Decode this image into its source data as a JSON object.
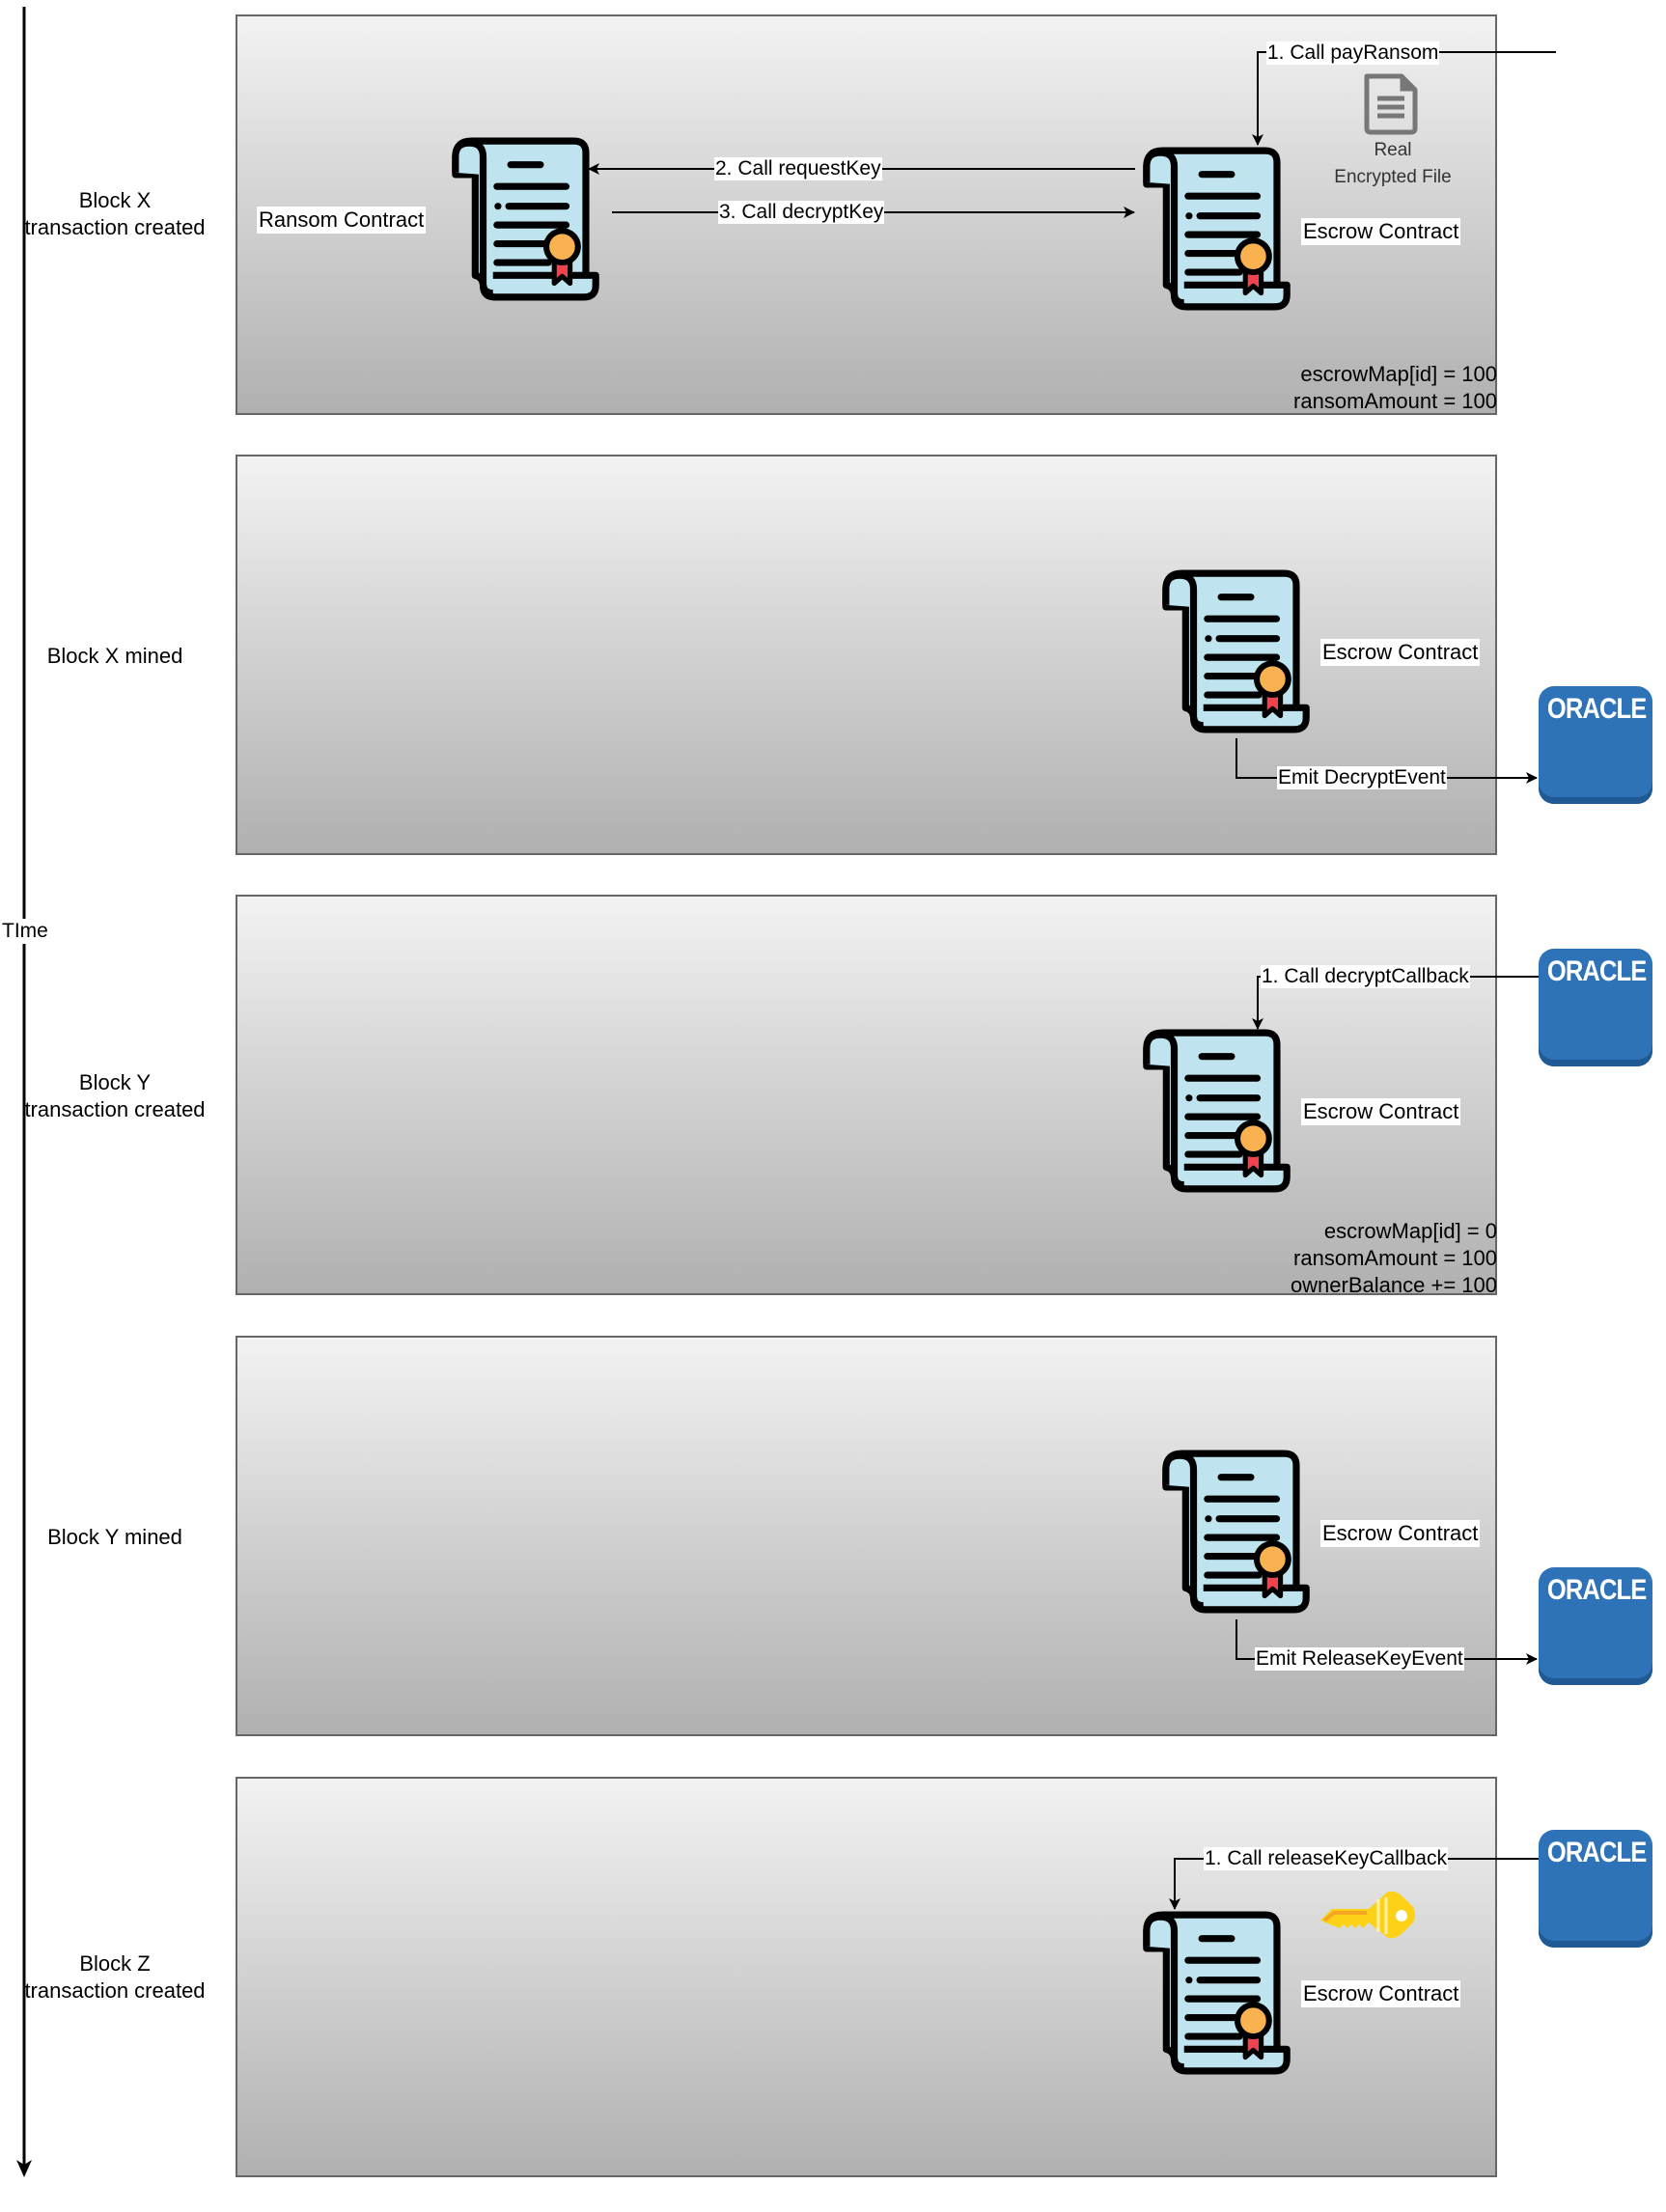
{
  "timeline": {
    "label": "TIme"
  },
  "rows": [
    {
      "label_line1": "Block X",
      "label_line2": "transaction created",
      "ransom_contract_label": "Ransom Contract",
      "escrow_contract_label": "Escrow Contract",
      "arrow_pay": "1. Call payRansom",
      "arrow_request": "2. Call requestKey",
      "arrow_decrypt": "3. Call decryptKey",
      "file_caption_line1": "Real",
      "file_caption_line2": "Encrypted File",
      "state": [
        "escrowMap[id] = 100",
        "ransomAmount = 100"
      ]
    },
    {
      "label_line1": "Block X mined",
      "escrow_contract_label": "Escrow Contract",
      "arrow_emit": "Emit DecryptEvent",
      "oracle": "ORACLE"
    },
    {
      "label_line1": "Block Y",
      "label_line2": "transaction created",
      "escrow_contract_label": "Escrow Contract",
      "arrow_call": "1. Call decryptCallback",
      "oracle": "ORACLE",
      "state": [
        "escrowMap[id] = 0",
        "ransomAmount = 100",
        "ownerBalance += 100"
      ]
    },
    {
      "label_line1": "Block Y mined",
      "escrow_contract_label": "Escrow Contract",
      "arrow_emit": "Emit ReleaseKeyEvent",
      "oracle": "ORACLE"
    },
    {
      "label_line1": "Block Z",
      "label_line2": "transaction created",
      "escrow_contract_label": "Escrow Contract",
      "arrow_call": "1. Call releaseKeyCallback",
      "oracle": "ORACLE"
    }
  ],
  "colors": {
    "oracle_fill": "#2e73b8",
    "scroll_fill": "#bfe3ef",
    "seal": "#f9b24f",
    "ribbon": "#f0424f",
    "key": "#fcd116"
  }
}
